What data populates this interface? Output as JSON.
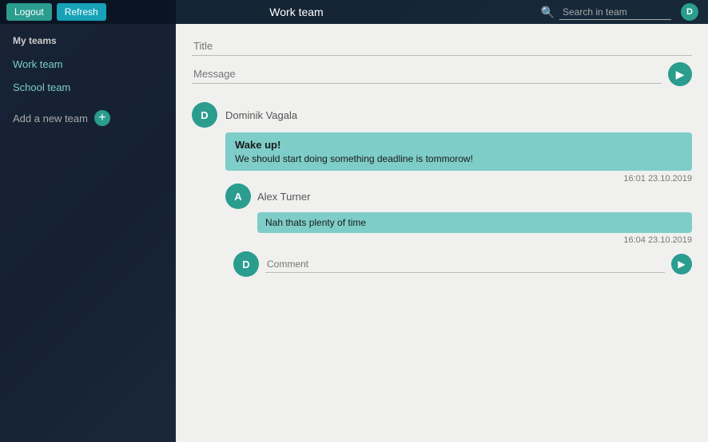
{
  "sidebar": {
    "logout_label": "Logout",
    "refresh_label": "Refresh",
    "my_teams_label": "My teams",
    "teams": [
      {
        "label": "Work team"
      },
      {
        "label": "School team"
      }
    ],
    "add_team_label": "Add a new team"
  },
  "topbar": {
    "title": "Work team",
    "search_placeholder": "Search in team"
  },
  "new_post": {
    "title_placeholder": "Title",
    "message_placeholder": "Message",
    "send_icon": "▶"
  },
  "posts": [
    {
      "author": "Dominik Vagala",
      "avatar_letter": "D",
      "title": "Wake up!",
      "message": "We should start doing something deadline is tommorow!",
      "timestamp": "16:01 23.10.2019",
      "replies": [
        {
          "author": "Alex Turner",
          "avatar_letter": "A",
          "message": "Nah thats plenty of time",
          "timestamp": "16:04 23.10.2019",
          "comment_placeholder": "Comment",
          "send_icon": "▶"
        }
      ]
    }
  ]
}
